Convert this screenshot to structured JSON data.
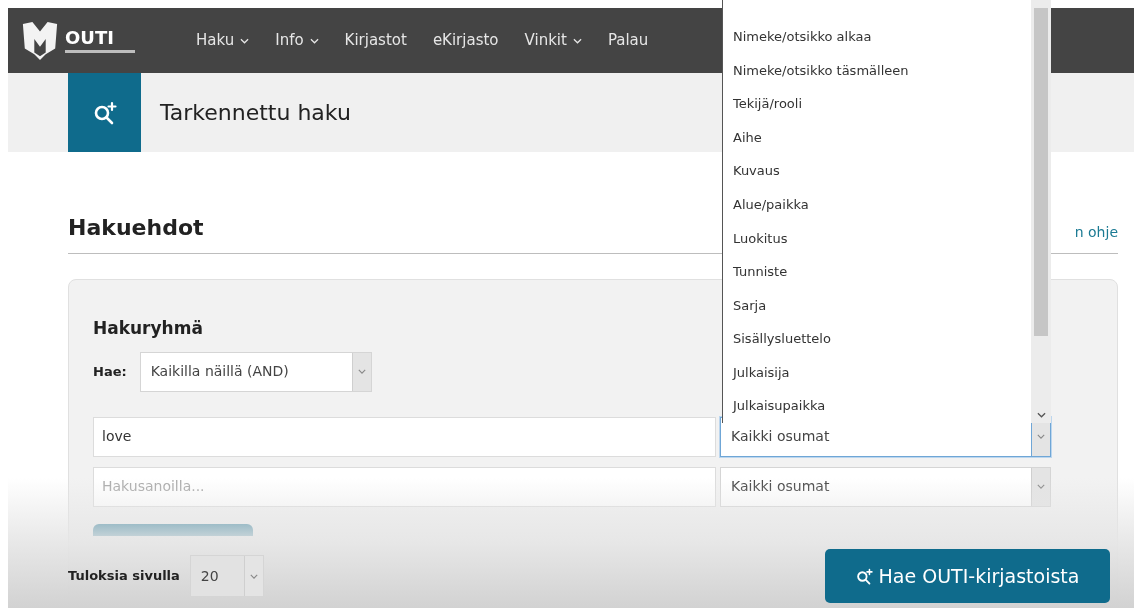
{
  "nav": {
    "logo": "OUTI",
    "items": [
      {
        "label": "Haku",
        "dropdown": true
      },
      {
        "label": "Info",
        "dropdown": true
      },
      {
        "label": "Kirjastot",
        "dropdown": false
      },
      {
        "label": "eKirjasto",
        "dropdown": false
      },
      {
        "label": "Vinkit",
        "dropdown": true
      },
      {
        "label": "Palau",
        "dropdown": false
      }
    ]
  },
  "page_header": {
    "title": "Tarkennettu haku"
  },
  "section": {
    "title": "Hakuehdot",
    "help_link": "n ohje"
  },
  "group": {
    "title": "Hakuryhmä",
    "operator_label": "Hae:",
    "operator_value": "Kaikilla näillä (AND)",
    "rows": [
      {
        "value": "love",
        "placeholder": "",
        "field": "Kaikki osumat",
        "focused": true
      },
      {
        "value": "",
        "placeholder": "Hakusanoilla...",
        "field": "Kaikki osumat",
        "focused": false
      }
    ]
  },
  "dropdown_options": [
    "Nimeke/otsikko alkaa",
    "Nimeke/otsikko täsmälleen",
    "Tekijä/rooli",
    "Aihe",
    "Kuvaus",
    "Alue/paikka",
    "Luokitus",
    "Tunniste",
    "Sarja",
    "Sisällysluettelo",
    "Julkaisija",
    "Julkaisupaikka"
  ],
  "footer": {
    "per_page_label": "Tuloksia sivulla",
    "per_page_value": "20",
    "search_button": "Hae OUTI-kirjastoista"
  }
}
